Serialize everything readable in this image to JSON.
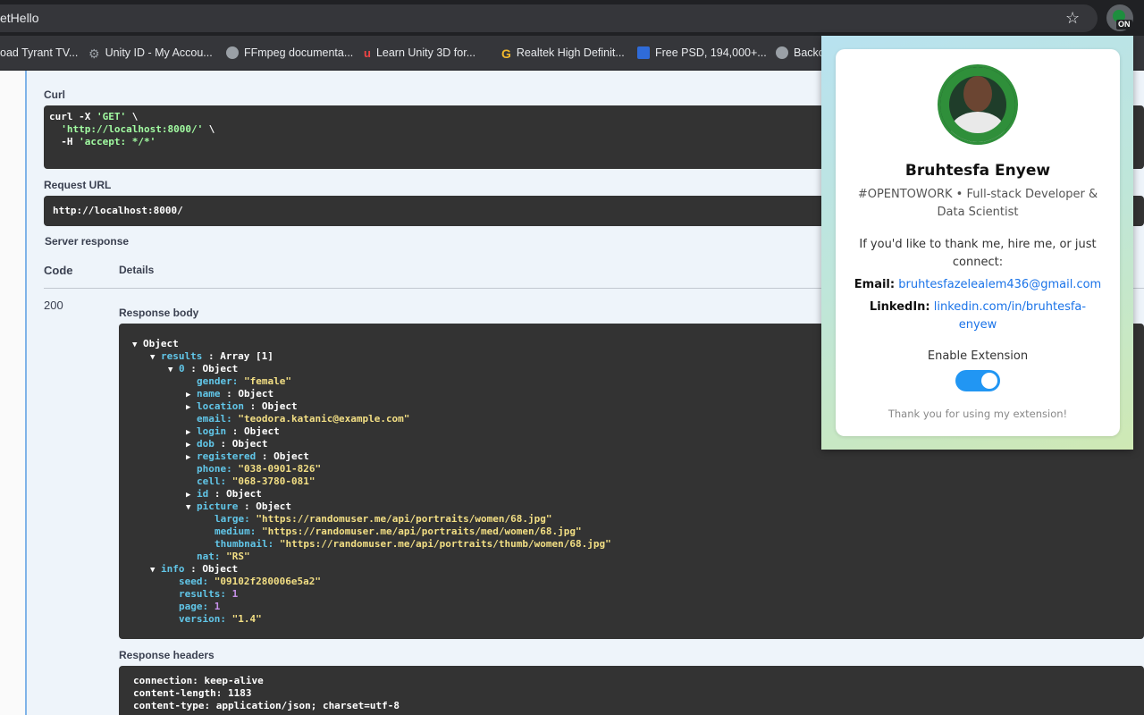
{
  "browser": {
    "address_text": "etHello",
    "star_icon": "star-icon",
    "extension_badge": "ON"
  },
  "bookmarks": [
    {
      "label": "oad Tyrant TV...",
      "icon": "none"
    },
    {
      "label": "Unity ID - My Accou...",
      "icon": "unity-icon"
    },
    {
      "label": "FFmpeg documenta...",
      "icon": "globe-icon"
    },
    {
      "label": "Learn Unity 3D for...",
      "icon": "udemy-icon"
    },
    {
      "label": "Realtek High Definit...",
      "icon": "g-icon"
    },
    {
      "label": "Free PSD, 194,000+...",
      "icon": "freepik-icon"
    },
    {
      "label": "Backc",
      "icon": "globe-icon"
    }
  ],
  "swagger": {
    "curl_label": "Curl",
    "curl_lines": [
      "curl -X ",
      "'GET'",
      " \\",
      "  'http://localhost:8000/'",
      " \\",
      "  -H ",
      "'accept: */*'"
    ],
    "request_url_label": "Request URL",
    "request_url": "http://localhost:8000/",
    "server_response_label": "Server response",
    "code_header": "Code",
    "details_header": "Details",
    "status_code": "200",
    "response_body_label": "Response body",
    "response_headers_label": "Response headers",
    "headers": [
      {
        "key": "connection",
        "value": "keep-alive"
      },
      {
        "key": "content-length",
        "value": "1183"
      },
      {
        "key": "content-type",
        "value": "application/json; charset=utf-8"
      }
    ]
  },
  "json_tree": [
    {
      "tw": "▼",
      "key": "Object",
      "sep": "",
      "val": "",
      "vclass": "",
      "kclass": "w"
    },
    {
      "tw": "▼",
      "key": "results",
      "sep": " : ",
      "val": "Array [1]",
      "vclass": "w",
      "kclass": "k"
    },
    {
      "tw": "▼",
      "key": "0",
      "sep": " : ",
      "val": "Object",
      "vclass": "w",
      "kclass": "k"
    },
    {
      "tw": "",
      "key": "gender:",
      "sep": " ",
      "val": "\"female\"",
      "vclass": "v",
      "kclass": "k"
    },
    {
      "tw": "▶",
      "key": "name",
      "sep": " : ",
      "val": "Object",
      "vclass": "w",
      "kclass": "k"
    },
    {
      "tw": "▶",
      "key": "location",
      "sep": " : ",
      "val": "Object",
      "vclass": "w",
      "kclass": "k"
    },
    {
      "tw": "",
      "key": "email:",
      "sep": " ",
      "val": "\"teodora.katanic@example.com\"",
      "vclass": "v",
      "kclass": "k"
    },
    {
      "tw": "▶",
      "key": "login",
      "sep": " : ",
      "val": "Object",
      "vclass": "w",
      "kclass": "k"
    },
    {
      "tw": "▶",
      "key": "dob",
      "sep": " : ",
      "val": "Object",
      "vclass": "w",
      "kclass": "k"
    },
    {
      "tw": "▶",
      "key": "registered",
      "sep": " : ",
      "val": "Object",
      "vclass": "w",
      "kclass": "k"
    },
    {
      "tw": "",
      "key": "phone:",
      "sep": " ",
      "val": "\"038-0901-826\"",
      "vclass": "v",
      "kclass": "k"
    },
    {
      "tw": "",
      "key": "cell:",
      "sep": " ",
      "val": "\"068-3780-081\"",
      "vclass": "v",
      "kclass": "k"
    },
    {
      "tw": "▶",
      "key": "id",
      "sep": " : ",
      "val": "Object",
      "vclass": "w",
      "kclass": "k"
    },
    {
      "tw": "▼",
      "key": "picture",
      "sep": " : ",
      "val": "Object",
      "vclass": "w",
      "kclass": "k"
    },
    {
      "tw": "",
      "key": "large:",
      "sep": " ",
      "val": "\"https://randomuser.me/api/portraits/women/68.jpg\"",
      "vclass": "v",
      "kclass": "k"
    },
    {
      "tw": "",
      "key": "medium:",
      "sep": " ",
      "val": "\"https://randomuser.me/api/portraits/med/women/68.jpg\"",
      "vclass": "v",
      "kclass": "k"
    },
    {
      "tw": "",
      "key": "thumbnail:",
      "sep": " ",
      "val": "\"https://randomuser.me/api/portraits/thumb/women/68.jpg\"",
      "vclass": "v",
      "kclass": "k"
    },
    {
      "tw": "",
      "key": "nat:",
      "sep": " ",
      "val": "\"RS\"",
      "vclass": "v",
      "kclass": "k"
    },
    {
      "tw": "▼",
      "key": "info",
      "sep": " : ",
      "val": "Object",
      "vclass": "w",
      "kclass": "k"
    },
    {
      "tw": "",
      "key": "seed:",
      "sep": " ",
      "val": "\"09102f280006e5a2\"",
      "vclass": "v",
      "kclass": "k"
    },
    {
      "tw": "",
      "key": "results:",
      "sep": " ",
      "val": "1",
      "vclass": "n",
      "kclass": "k"
    },
    {
      "tw": "",
      "key": "page:",
      "sep": " ",
      "val": "1",
      "vclass": "n",
      "kclass": "k"
    },
    {
      "tw": "",
      "key": "version:",
      "sep": " ",
      "val": "\"1.4\"",
      "vclass": "v",
      "kclass": "k"
    }
  ],
  "popup": {
    "name": "Bruhtesfa Enyew",
    "tagline": "#OPENTOWORK • Full-stack Developer & Data Scientist",
    "thanks": "If you'd like to thank me, hire me, or just connect:",
    "email_label": "Email:",
    "email": "bruhtesfazelealem436@gmail.com",
    "linkedin_label": "LinkedIn:",
    "linkedin": "linkedin.com/in/bruhtesfa-enyew",
    "enable_label": "Enable Extension",
    "enabled": true,
    "footer": "Thank you for using my extension!"
  }
}
